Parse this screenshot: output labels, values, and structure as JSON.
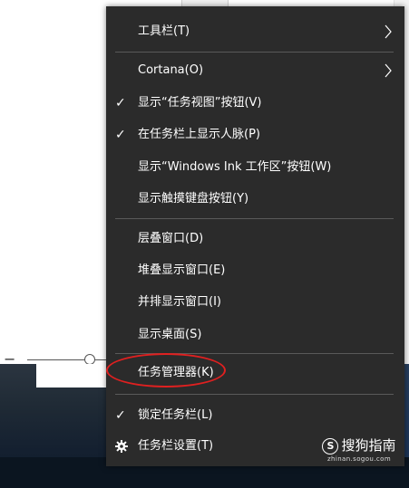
{
  "context_menu": {
    "items": [
      {
        "label": "工具栏(T)",
        "checked": false,
        "submenu": true
      },
      {
        "label": "Cortana(O)",
        "checked": false,
        "submenu": true
      },
      {
        "label": "显示“任务视图”按钮(V)",
        "checked": true,
        "submenu": false
      },
      {
        "label": "在任务栏上显示人脉(P)",
        "checked": true,
        "submenu": false
      },
      {
        "label": "显示“Windows Ink 工作区”按钮(W)",
        "checked": false,
        "submenu": false
      },
      {
        "label": "显示触摸键盘按钮(Y)",
        "checked": false,
        "submenu": false
      },
      {
        "label": "层叠窗口(D)",
        "checked": false,
        "submenu": false
      },
      {
        "label": "堆叠显示窗口(E)",
        "checked": false,
        "submenu": false
      },
      {
        "label": "并排显示窗口(I)",
        "checked": false,
        "submenu": false
      },
      {
        "label": "显示桌面(S)",
        "checked": false,
        "submenu": false
      },
      {
        "label": "任务管理器(K)",
        "checked": false,
        "submenu": false,
        "highlighted_by_annotation": true
      },
      {
        "label": "锁定任务栏(L)",
        "checked": true,
        "submenu": false
      },
      {
        "label": "任务栏设置(T)",
        "checked": false,
        "submenu": false,
        "icon": "gear-icon"
      }
    ],
    "check_glyph": "✓",
    "annotation_color": "#e02020"
  },
  "watermark": {
    "logo_glyph": "S",
    "brand": "搜狗指南",
    "url": "zhinan.sogou.com"
  },
  "background": {
    "zoom_minus": "−"
  }
}
